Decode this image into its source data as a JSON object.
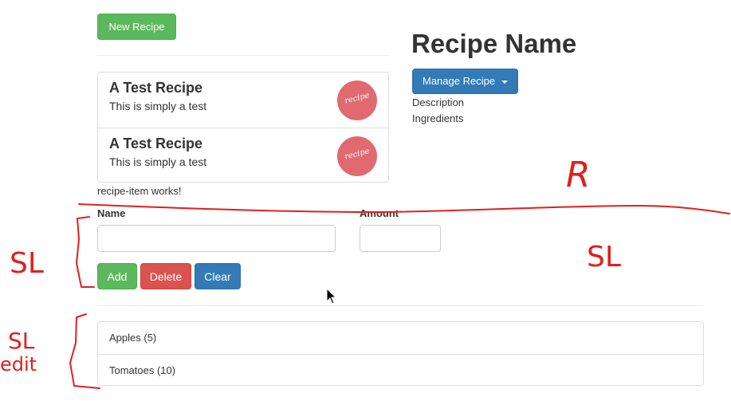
{
  "recipe_list": {
    "new_button": "New Recipe",
    "items": [
      {
        "name": "A Test Recipe",
        "description": "This is simply a test",
        "image_text": "recipe"
      },
      {
        "name": "A Test Recipe",
        "description": "This is simply a test",
        "image_text": "recipe"
      }
    ],
    "status_text": "recipe-item works!"
  },
  "recipe_detail": {
    "title": "Recipe Name",
    "manage_button": "Manage Recipe",
    "description_label": "Description",
    "ingredients_label": "Ingredients"
  },
  "shopping_edit": {
    "name_label": "Name",
    "amount_label": "Amount",
    "name_value": "",
    "amount_value": "",
    "add_button": "Add",
    "delete_button": "Delete",
    "clear_button": "Clear"
  },
  "shopping_list": {
    "items": [
      "Apples (5)",
      "Tomatoes (10)"
    ]
  },
  "annotations": {
    "r": "R",
    "sl_left": "SL",
    "sl_right": "SL",
    "sl_edit_1": "SL",
    "sl_edit_2": "edit"
  },
  "colors": {
    "success": "#5cb85c",
    "danger": "#d9534f",
    "primary": "#337ab7",
    "ink": "#e0201e"
  }
}
